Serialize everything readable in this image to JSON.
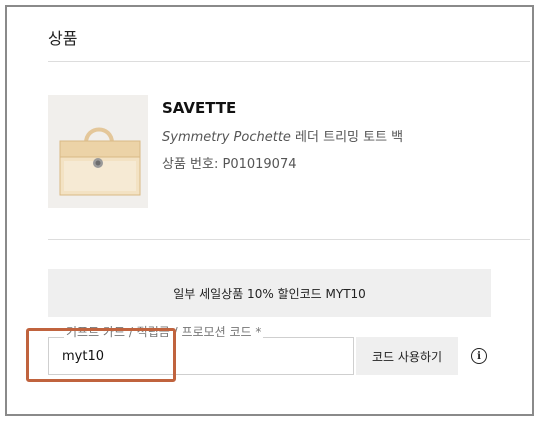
{
  "section": {
    "title": "상품"
  },
  "product": {
    "brand": "SAVETTE",
    "name_en": "Symmetry Pochette",
    "name_ko": " 레더 트리밍 토트 백",
    "number": "상품 번호: P01019074",
    "image_icon": "handbag-image"
  },
  "promo": {
    "banner": "일부 세일상품 10% 할인코드 MYT10",
    "field_label": "기프트 카드 / 적립금 / 프로모션 코드 *",
    "code_value": "myt10",
    "apply_label": "코드 사용하기",
    "info_icon": "info-icon"
  },
  "colors": {
    "highlight": "#c0633e",
    "banner_bg": "#efefef"
  }
}
